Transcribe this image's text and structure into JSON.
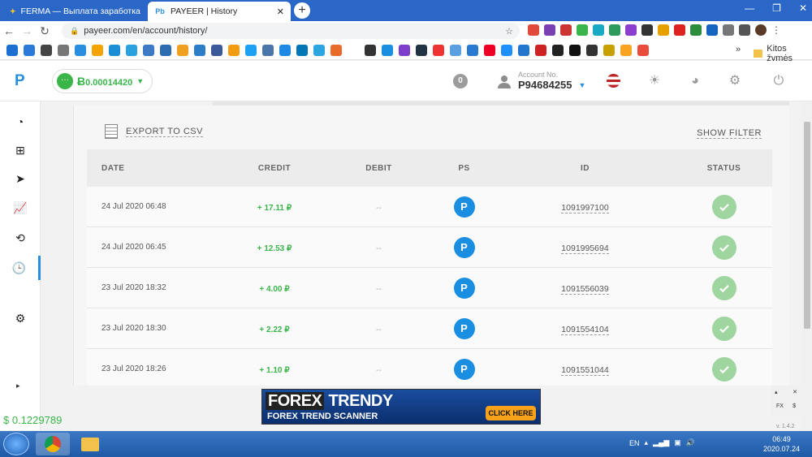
{
  "browser": {
    "tabs": [
      {
        "title": "FERMA — Выплата заработка",
        "active": false
      },
      {
        "title": "PAYEER | History",
        "active": true
      }
    ],
    "url": "payeer.com/en/account/history/",
    "bookmarks_folder": "Kitos žymės",
    "bookmarks_more": "»"
  },
  "header": {
    "logo": "P",
    "balance_currency": "Ƀ",
    "balance_amount": "0.00014420",
    "notifications": "0",
    "account_label": "Account No.",
    "account_number": "P94684255"
  },
  "toolbar": {
    "export_label": "EXPORT TO CSV",
    "filter_label": "SHOW FILTER"
  },
  "table": {
    "columns": [
      "DATE",
      "CREDIT",
      "DEBIT",
      "PS",
      "ID",
      "STATUS"
    ],
    "rows": [
      {
        "date": "24 Jul 2020 06:48",
        "credit": "+ 17.11 ₽",
        "debit": "--",
        "ps": "P",
        "id": "1091997100"
      },
      {
        "date": "24 Jul 2020 06:45",
        "credit": "+ 12.53 ₽",
        "debit": "--",
        "ps": "P",
        "id": "1091995694"
      },
      {
        "date": "23 Jul 2020 18:32",
        "credit": "+ 4.00 ₽",
        "debit": "--",
        "ps": "P",
        "id": "1091556039"
      },
      {
        "date": "23 Jul 2020 18:30",
        "credit": "+ 2.22 ₽",
        "debit": "--",
        "ps": "P",
        "id": "1091554104"
      },
      {
        "date": "23 Jul 2020 18:26",
        "credit": "+ 1.10 ₽",
        "debit": "--",
        "ps": "P",
        "id": "1091551044"
      }
    ]
  },
  "overlay": {
    "usd_balance": "$ 0.1229789",
    "ad_line1_a": "FOREX",
    "ad_line1_b": "TRENDY",
    "ad_line2": "FOREX TREND SCANNER",
    "ad_cta": "CLICK HERE",
    "fx_label": "FX",
    "fx_symbol": "$",
    "version": "v. 1.4.2"
  },
  "taskbar": {
    "lang": "EN",
    "time": "06:49",
    "date": "2020.07.24"
  },
  "colors": {
    "accent": "#2a8ee0",
    "credit_green": "#3ab54a",
    "tabstrip": "#2a67c6"
  }
}
